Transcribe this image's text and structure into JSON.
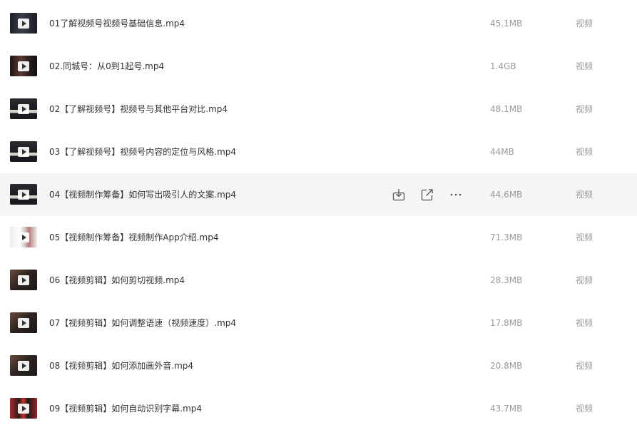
{
  "files": [
    {
      "name": "01了解视频号视频号基础信息.mp4",
      "size": "45.1MB",
      "type": "视频",
      "thumb": "dark-studio"
    },
    {
      "name": "02.同城号：从0到1起号.mp4",
      "size": "1.4GB",
      "type": "视频",
      "thumb": "portrait-red"
    },
    {
      "name": "02【了解视频号】视频号与其他平台对比.mp4",
      "size": "48.1MB",
      "type": "视频",
      "thumb": "slide-dark"
    },
    {
      "name": "03【了解视频号】视频号内容的定位与风格.mp4",
      "size": "44MB",
      "type": "视频",
      "thumb": "slide-dark"
    },
    {
      "name": "04【视频制作筹备】如何写出吸引人的文案.mp4",
      "size": "44.6MB",
      "type": "视频",
      "thumb": "slide-dark"
    },
    {
      "name": "05【视频制作筹备】视频制作App介绍.mp4",
      "size": "71.3MB",
      "type": "视频",
      "thumb": "phone-white"
    },
    {
      "name": "06【视频剪辑】如何剪切视频.mp4",
      "size": "28.3MB",
      "type": "视频",
      "thumb": "desk-warm"
    },
    {
      "name": "07【视频剪辑】如何调整语速（视频速度）.mp4",
      "size": "17.8MB",
      "type": "视频",
      "thumb": "desk-warm"
    },
    {
      "name": "08【视频剪辑】如何添加画外音.mp4",
      "size": "20.8MB",
      "type": "视频",
      "thumb": "desk-warm"
    },
    {
      "name": "09【视频剪辑】如何自动识别字幕.mp4",
      "size": "43.7MB",
      "type": "视频",
      "thumb": "grid-red"
    }
  ],
  "hovered_row": 4,
  "row_actions": {
    "download": "download-icon",
    "share": "open-external-icon",
    "more": "more-horizontal-icon"
  },
  "colors": {
    "hover_bg": "#f5f5f6",
    "text": "#333333",
    "muted": "#9a9a9a"
  }
}
